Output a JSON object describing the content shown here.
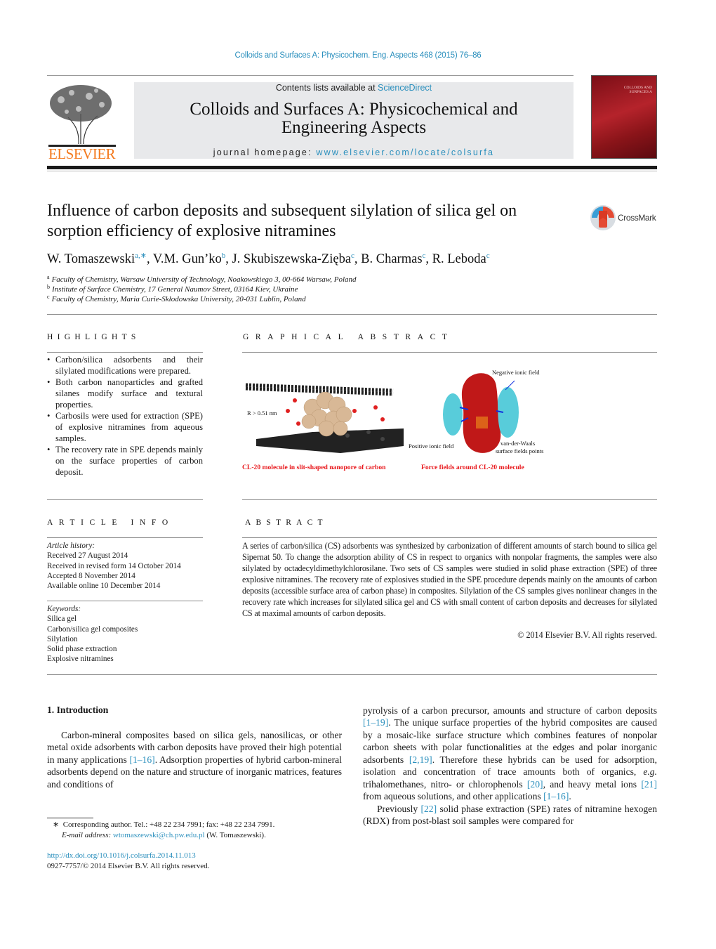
{
  "header": {
    "journal_ref": "Colloids and Surfaces A: Physicochem. Eng. Aspects 468 (2015) 76–86",
    "contents_prefix": "Contents lists available at ",
    "contents_link": "ScienceDirect",
    "journal_title_line1": "Colloids and Surfaces A: Physicochemical and",
    "journal_title_line2": "Engineering Aspects",
    "homepage_prefix": "journal homepage: ",
    "homepage_link": "www.elsevier.com/locate/colsurfa",
    "publisher_logo": "ELSEVIER",
    "cover_title": "COLLOIDS AND SURFACES A"
  },
  "colors": {
    "link": "#2a8fbd",
    "elsevier_orange": "#f47b20",
    "caption_red": "#e8171b"
  },
  "article": {
    "title_line1": "Influence of carbon deposits and subsequent silylation of silica gel on",
    "title_line2": "sorption efficiency of explosive nitramines",
    "crossmark": "CrossMark",
    "authors": [
      {
        "name": "W. Tomaszewski",
        "sup": "a,∗"
      },
      {
        "name": "V.M. Gun’ko",
        "sup": "b"
      },
      {
        "name": "J. Skubiszewska-Zięba",
        "sup": "c"
      },
      {
        "name": "B. Charmas",
        "sup": "c"
      },
      {
        "name": "R. Leboda",
        "sup": "c"
      }
    ],
    "affiliations": [
      {
        "sup": "a",
        "text": "Faculty of Chemistry, Warsaw University of Technology, Noakowskiego 3, 00-664 Warsaw, Poland"
      },
      {
        "sup": "b",
        "text": "Institute of Surface Chemistry, 17 General Naumov Street, 03164 Kiev, Ukraine"
      },
      {
        "sup": "c",
        "text": "Faculty of Chemistry, Maria Curie-Skłodowska University, 20-031 Lublin, Poland"
      }
    ]
  },
  "highlights": {
    "heading": "HIGHLIGHTS",
    "items": [
      "Carbon/silica adsorbents and their silylated modifications were prepared.",
      "Both carbon nanoparticles and grafted silanes modify surface and textural properties.",
      "Carbosils were used for extraction (SPE) of explosive nitramines from aqueous samples.",
      "The recovery rate in SPE depends mainly on the surface properties of carbon deposit."
    ]
  },
  "graphical_abstract": {
    "heading": "GRAPHICAL ABSTRACT",
    "left_label": "R > 0.51 nm",
    "left_caption": "CL-20 molecule in slit-shaped nanopore of carbon",
    "right_labels": {
      "negative": "Negative ionic field",
      "positive": "Positive ionic field",
      "vdw_line1": "van-der-Waals",
      "vdw_line2": "surface fields points"
    },
    "right_caption": "Force fields around CL-20 molecule"
  },
  "article_info": {
    "heading": "ARTICLE INFO",
    "history_label": "Article history:",
    "history": [
      "Received 27 August 2014",
      "Received in revised form 14 October 2014",
      "Accepted 8 November 2014",
      "Available online 10 December 2014"
    ],
    "keywords_label": "Keywords:",
    "keywords": [
      "Silica gel",
      "Carbon/silica gel composites",
      "Silylation",
      "Solid phase extraction",
      "Explosive nitramines"
    ]
  },
  "abstract": {
    "heading": "ABSTRACT",
    "text": "A series of carbon/silica (CS) adsorbents was synthesized by carbonization of different amounts of starch bound to silica gel Sipernat 50. To change the adsorption ability of CS in respect to organics with nonpolar fragments, the samples were also silylated by octadecyldimethylchlorosilane. Two sets of CS samples were studied in solid phase extraction (SPE) of three explosive nitramines. The recovery rate of explosives studied in the SPE procedure depends mainly on the amounts of carbon deposits (accessible surface area of carbon phase) in composites. Silylation of the CS samples gives nonlinear changes in the recovery rate which increases for silylated silica gel and CS with small content of carbon deposits and decreases for silylated CS at maximal amounts of carbon deposits.",
    "copyright": "© 2014 Elsevier B.V. All rights reserved."
  },
  "body": {
    "section_heading": "1.  Introduction",
    "left_paragraphs": [
      [
        {
          "t": "Carbon-mineral composites based on silica gels, nanosilicas, or other metal oxide adsorbents with carbon deposits have proved their high potential in many applications "
        },
        {
          "r": "[1–16]"
        },
        {
          "t": ". Adsorption properties of hybrid carbon-mineral adsorbents depend on the nature and structure of inorganic matrices, features and conditions of"
        }
      ]
    ],
    "right_paragraphs": [
      [
        {
          "t": "pyrolysis of a carbon precursor, amounts and structure of carbon deposits "
        },
        {
          "r": "[1–19]"
        },
        {
          "t": ". The unique surface properties of the hybrid composites are caused by a mosaic-like surface structure which combines features of nonpolar carbon sheets with polar functionalities at the edges and polar inorganic adsorbents "
        },
        {
          "r": "[2,19]"
        },
        {
          "t": ". Therefore these hybrids can be used for adsorption, isolation and concentration of trace amounts both of organics, "
        },
        {
          "i": "e.g."
        },
        {
          "t": " trihalomethanes, nitro- or chlorophenols "
        },
        {
          "r": "[20]"
        },
        {
          "t": ", and heavy metal ions "
        },
        {
          "r": "[21]"
        },
        {
          "t": " from aqueous solutions, and other applications "
        },
        {
          "r": "[1–16]"
        },
        {
          "t": "."
        }
      ],
      [
        {
          "t": "Previously "
        },
        {
          "r": "[22]"
        },
        {
          "t": " solid phase extraction (SPE) rates of nitramine hexogen (RDX) from post-blast soil samples were compared for"
        }
      ]
    ]
  },
  "footnotes": {
    "corresponding": "Corresponding author. Tel.: +48 22 234 7991; fax: +48 22 234 7991.",
    "corresponding_mark": "∗",
    "email_label": "E-mail address:",
    "email": "wtomaszewski@ch.pw.edu.pl",
    "email_suffix": " (W. Tomaszewski).",
    "doi": "http://dx.doi.org/10.1016/j.colsurfa.2014.11.013",
    "issn_line": "0927-7757/© 2014 Elsevier B.V. All rights reserved."
  }
}
